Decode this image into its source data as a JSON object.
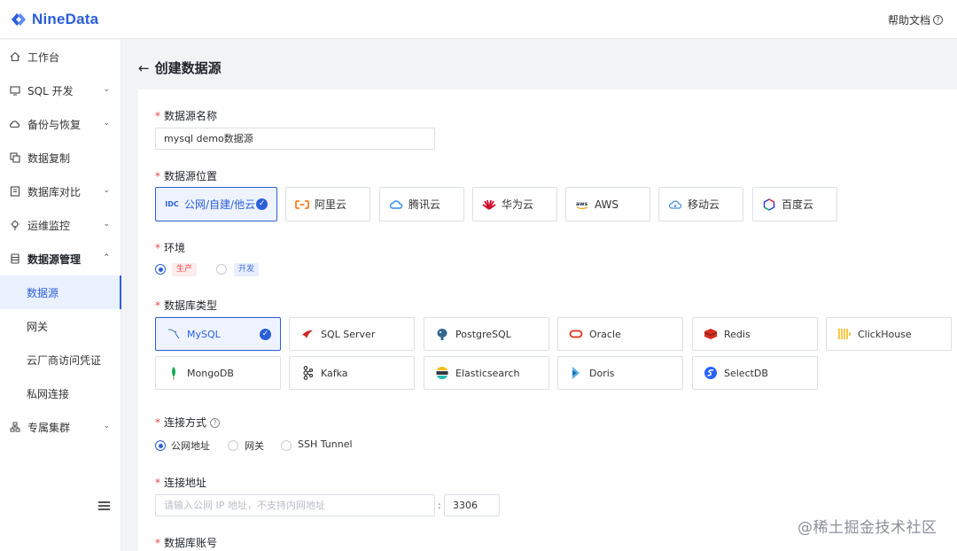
{
  "app": {
    "brand": "NineData",
    "brand_color": "#2b5fd9",
    "help_label": "帮助文档"
  },
  "sidebar": {
    "items": [
      {
        "label": "工作台",
        "icon": "home-icon"
      },
      {
        "label": "SQL 开发",
        "icon": "monitor-icon",
        "expandable": true
      },
      {
        "label": "备份与恢复",
        "icon": "cloud-icon",
        "expandable": true
      },
      {
        "label": "数据复制",
        "icon": "copy-icon"
      },
      {
        "label": "数据库对比",
        "icon": "compare-icon",
        "expandable": true
      },
      {
        "label": "运维监控",
        "icon": "bulb-icon",
        "expandable": true
      },
      {
        "label": "数据源管理",
        "icon": "database-icon",
        "expanded": true
      },
      {
        "label": "数据源",
        "active": true
      },
      {
        "label": "网关"
      },
      {
        "label": "云厂商访问凭证"
      },
      {
        "label": "私网连接"
      },
      {
        "label": "专属集群",
        "icon": "cluster-icon",
        "expandable": true
      }
    ]
  },
  "page": {
    "title": "创建数据源"
  },
  "form": {
    "name": {
      "label": "数据源名称",
      "value": "mysql demo数据源"
    },
    "location": {
      "label": "数据源位置",
      "options": [
        {
          "label": "公网/自建/他云",
          "icon": "idc-icon",
          "selected": true
        },
        {
          "label": "阿里云",
          "icon": "aliyun-icon"
        },
        {
          "label": "腾讯云",
          "icon": "tencent-cloud-icon"
        },
        {
          "label": "华为云",
          "icon": "huawei-cloud-icon"
        },
        {
          "label": "AWS",
          "icon": "aws-icon"
        },
        {
          "label": "移动云",
          "icon": "mobile-cloud-icon"
        },
        {
          "label": "百度云",
          "icon": "baidu-cloud-icon"
        }
      ]
    },
    "env": {
      "label": "环境",
      "options": [
        {
          "label": "生产",
          "selected": true,
          "color": "#e84749"
        },
        {
          "label": "开发",
          "selected": false,
          "color": "#4a6fd8"
        }
      ]
    },
    "db_type": {
      "label": "数据库类型",
      "options": [
        {
          "label": "MySQL",
          "icon": "mysql-icon",
          "selected": true
        },
        {
          "label": "SQL Server",
          "icon": "sqlserver-icon"
        },
        {
          "label": "PostgreSQL",
          "icon": "postgresql-icon"
        },
        {
          "label": "Oracle",
          "icon": "oracle-icon"
        },
        {
          "label": "Redis",
          "icon": "redis-icon"
        },
        {
          "label": "ClickHouse",
          "icon": "clickhouse-icon"
        },
        {
          "label": "MongoDB",
          "icon": "mongodb-icon"
        },
        {
          "label": "Kafka",
          "icon": "kafka-icon"
        },
        {
          "label": "Elasticsearch",
          "icon": "elasticsearch-icon"
        },
        {
          "label": "Doris",
          "icon": "doris-icon"
        },
        {
          "label": "SelectDB",
          "icon": "selectdb-icon"
        }
      ]
    },
    "conn_method": {
      "label": "连接方式",
      "options": [
        {
          "label": "公网地址",
          "selected": true
        },
        {
          "label": "网关",
          "selected": false
        },
        {
          "label": "SSH Tunnel",
          "selected": false
        }
      ]
    },
    "address": {
      "label": "连接地址",
      "host_placeholder": "请输入公网 IP 地址，不支持内网地址",
      "separator": ":",
      "port": "3306"
    },
    "account": {
      "label": "数据库账号"
    }
  },
  "watermark": "@稀土掘金技术社区"
}
